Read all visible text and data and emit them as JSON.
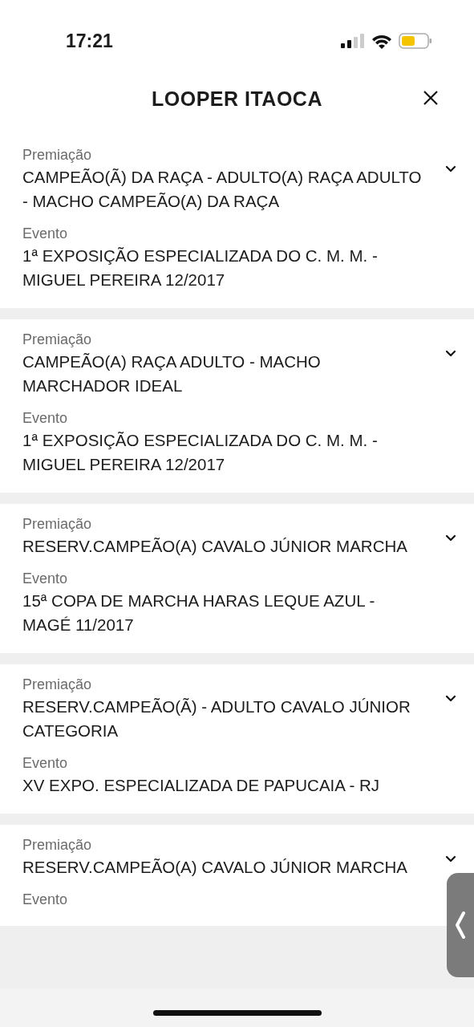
{
  "status_bar": {
    "time": "17:21"
  },
  "header": {
    "title": "LOOPER ITAOCA"
  },
  "awards": [
    {
      "award_label": "Premiação",
      "award": "CAMPEÃO(Ã) DA RAÇA - ADULTO(A) RAÇA ADULTO - MACHO CAMPEÃO(A) DA RAÇA",
      "event_label": "Evento",
      "event": "1ª EXPOSIÇÃO ESPECIALIZADA DO C. M. M. - MIGUEL PEREIRA 12/2017",
      "expanded": false
    },
    {
      "award_label": "Premiação",
      "award": "CAMPEÃO(A) RAÇA ADULTO - MACHO MARCHADOR IDEAL",
      "event_label": "Evento",
      "event": "1ª EXPOSIÇÃO ESPECIALIZADA DO C. M. M. - MIGUEL PEREIRA 12/2017",
      "expanded": false
    },
    {
      "award_label": "Premiação",
      "award": "RESERV.CAMPEÃO(A) CAVALO JÚNIOR MARCHA",
      "event_label": "Evento",
      "event": "15ª COPA DE MARCHA HARAS LEQUE AZUL - MAGÉ 11/2017",
      "expanded": false
    },
    {
      "award_label": "Premiação",
      "award": "RESERV.CAMPEÃO(Ã) - ADULTO CAVALO JÚNIOR CATEGORIA",
      "event_label": "Evento",
      "event": "XV EXPO. ESPECIALIZADA DE PAPUCAIA - RJ",
      "expanded": false
    },
    {
      "award_label": "Premiação",
      "award": "RESERV.CAMPEÃO(A) CAVALO JÚNIOR MARCHA",
      "event_label": "Evento",
      "expanded": false
    }
  ]
}
